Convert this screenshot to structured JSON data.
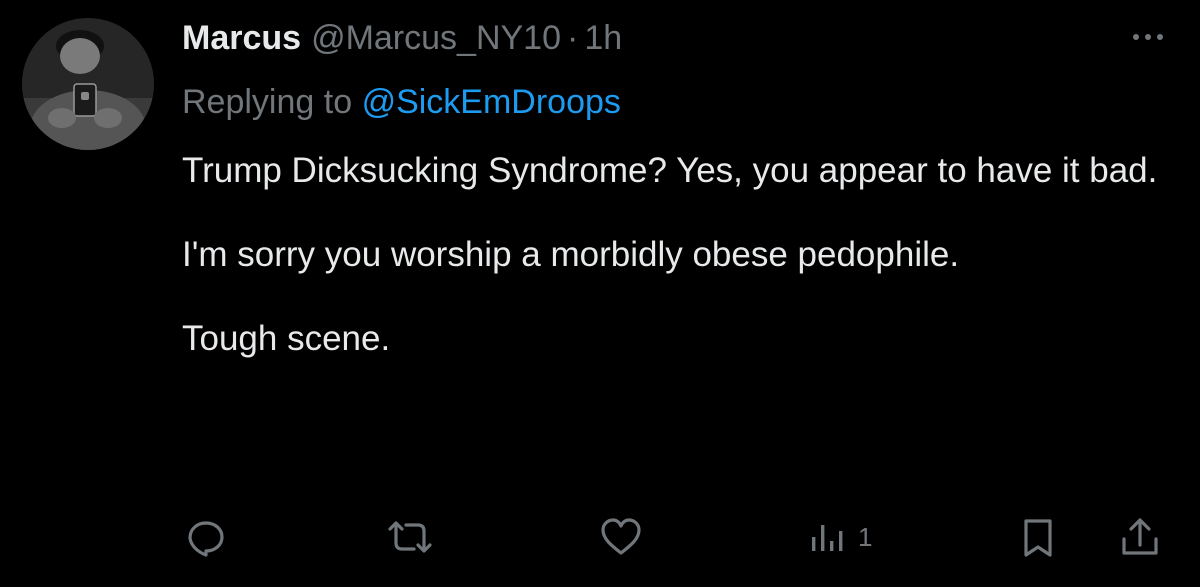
{
  "tweet": {
    "author_name": "Marcus",
    "author_handle": "@Marcus_NY10",
    "separator": "·",
    "timestamp": "1h",
    "replying_prefix": "Replying to",
    "replying_to": "@SickEmDroops",
    "paragraphs": [
      "Trump Dicksucking Syndrome? Yes, you appear to have it bad.",
      "I'm sorry you worship a morbidly obese pedophile.",
      "Tough scene."
    ]
  },
  "actions": {
    "views_count": "1"
  },
  "icons": {
    "more": "more-horizontal-icon",
    "reply": "reply-icon",
    "retweet": "retweet-icon",
    "like": "heart-icon",
    "views": "views-chart-icon",
    "bookmark": "bookmark-icon",
    "share": "share-icon"
  },
  "colors": {
    "background": "#000000",
    "text": "#e7e9ea",
    "secondary": "#71767b",
    "link": "#1d9bf0"
  }
}
